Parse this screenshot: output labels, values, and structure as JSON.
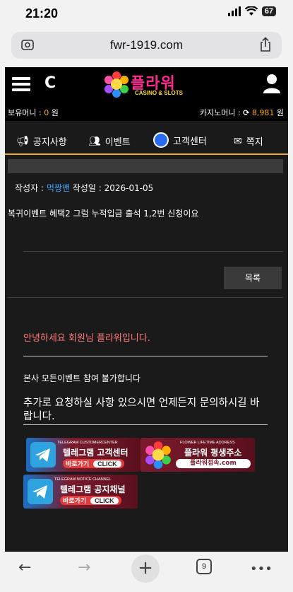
{
  "status": {
    "time": "21:20",
    "battery": "67"
  },
  "browser": {
    "url": "fwr-1919.com",
    "tab_count": "9"
  },
  "header": {
    "logo_text": "플라워",
    "logo_sub": "CASINO & SLOTS",
    "money_label": "보유머니 :",
    "money_value": "0",
    "money_unit": "원",
    "casino_label": "카지노머니 :",
    "casino_value": "8,981",
    "casino_unit": "원"
  },
  "tabs": [
    {
      "label": "공지사항",
      "icon": "megaphone-icon"
    },
    {
      "label": "이벤트",
      "icon": "people-icon"
    },
    {
      "label": "고객센터",
      "icon": "headset-icon",
      "active": true
    },
    {
      "label": "쪽지",
      "icon": "mail-icon"
    }
  ],
  "post": {
    "author_label": "작성자 :",
    "author": "먹짱맨",
    "date_label": "작성일 :",
    "date": "2026-01-05",
    "content": "복귀이벤트 혜택2 그럼 누적입금 출석 1,2번 신청이요",
    "list_button": "목록"
  },
  "reply": {
    "greeting": "안녕하세요 회원님 플라워입니다.",
    "line1": "본사 모든이벤트 참여 불가합니다",
    "line2": "추가로 요청하실 사항 있으시면 언제든지 문의하시길 바랍니다."
  },
  "banners": {
    "b1": {
      "small": "TELEGRAM CUSTOMERCENTER",
      "title": "텔레그램 고객센터",
      "cta": "바로가기",
      "click": "CLICK"
    },
    "b2": {
      "small": "FLOWER LIFETIME ADDRESS",
      "title": "플라워 평생주소",
      "cta": "플라워접속.com"
    },
    "b3": {
      "small": "TELEGRAM NOTICE CHANNEL",
      "title": "텔레그램 공지채널",
      "cta": "바로가기",
      "click": "CLICK"
    }
  },
  "colors": {
    "accent": "#e8b03a",
    "link": "#45a7ff",
    "greeting": "#ff7a7a",
    "gold": "#ffae00"
  }
}
